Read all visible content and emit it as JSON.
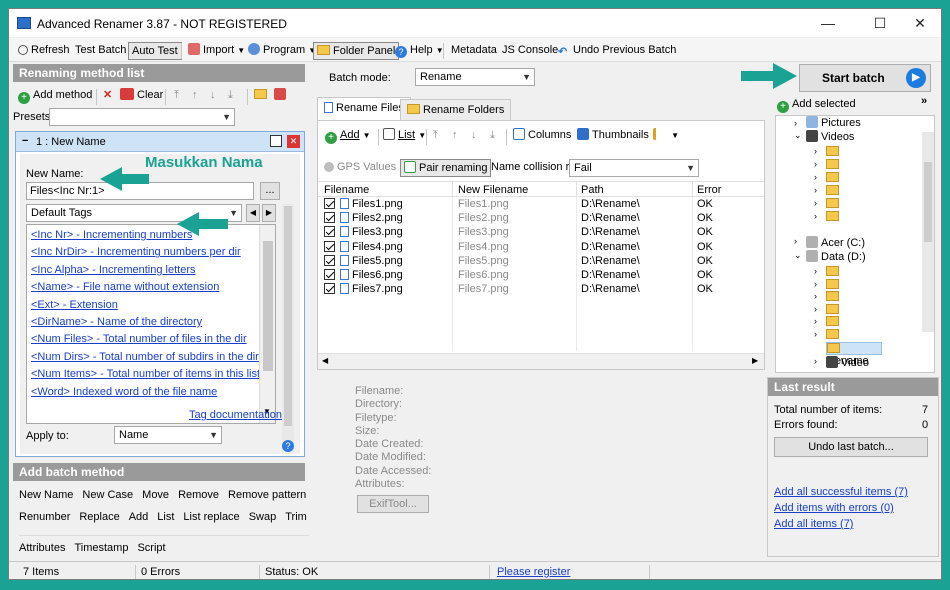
{
  "window": {
    "title": "Advanced Renamer 3.87 - NOT REGISTERED",
    "controls": {
      "minimize": "—",
      "maximize": "☐",
      "close": "✕"
    }
  },
  "toolbar": {
    "refresh": "Refresh",
    "test_batch": "Test Batch",
    "auto_test": "Auto Test",
    "import": "Import",
    "program": "Program",
    "folder_panel": "Folder Panel",
    "help": "Help",
    "metadata": "Metadata",
    "js_console": "JS Console",
    "undo_previous_batch": "Undo Previous Batch"
  },
  "methods_panel": {
    "header": "Renaming method list",
    "add_method": "Add method",
    "clear": "Clear",
    "presets_label": "Presets:",
    "presets_value": "",
    "method_title": "1 : New Name",
    "new_name_label": "New Name:",
    "new_name_value": "Files<Inc Nr:1>",
    "browse_btn": "...",
    "default_tags": "Default Tags",
    "tags": [
      "<Inc Nr> - Incrementing numbers",
      "<Inc NrDir> - Incrementing numbers per dir",
      "<Inc Alpha> - Incrementing letters",
      "<Name> - File name without extension",
      "<Ext> - Extension",
      "<DirName> - Name of the directory",
      "<Num Files> - Total number of files in the dir",
      "<Num Dirs> - Total number of subdirs in the dir",
      "<Num Items> - Total number of items in this list",
      "<Word> Indexed word of the file name"
    ],
    "tag_documentation": "Tag documentation",
    "apply_to_label": "Apply to:",
    "apply_to_value": "Name"
  },
  "annotations": {
    "masukkan_nama": "Masukkan Nama"
  },
  "batch_methods": {
    "header": "Add batch method",
    "rows": [
      [
        "New Name",
        "New Case",
        "Move",
        "Remove",
        "Remove pattern"
      ],
      [
        "Renumber",
        "Replace",
        "Add",
        "List",
        "List replace",
        "Swap",
        "Trim"
      ],
      [
        "Attributes",
        "Timestamp",
        "Script"
      ]
    ]
  },
  "center": {
    "batch_mode_label": "Batch mode:",
    "batch_mode_value": "Rename",
    "tab_files": "Rename Files",
    "tab_folders": "Rename Folders",
    "add": "Add",
    "list": "List",
    "columns": "Columns",
    "thumbnails": "Thumbnails",
    "gps_values": "GPS Values",
    "pair_renaming": "Pair renaming",
    "collision_label": "Name collision rule:",
    "collision_value": "Fail",
    "headers": [
      "Filename",
      "New Filename",
      "Path",
      "Error"
    ],
    "rows": [
      {
        "filename": "Files1.png",
        "new": "Files1.png",
        "path": "D:\\Rename\\",
        "error": "OK"
      },
      {
        "filename": "Files2.png",
        "new": "Files2.png",
        "path": "D:\\Rename\\",
        "error": "OK"
      },
      {
        "filename": "Files3.png",
        "new": "Files3.png",
        "path": "D:\\Rename\\",
        "error": "OK"
      },
      {
        "filename": "Files4.png",
        "new": "Files4.png",
        "path": "D:\\Rename\\",
        "error": "OK"
      },
      {
        "filename": "Files5.png",
        "new": "Files5.png",
        "path": "D:\\Rename\\",
        "error": "OK"
      },
      {
        "filename": "Files6.png",
        "new": "Files6.png",
        "path": "D:\\Rename\\",
        "error": "OK"
      },
      {
        "filename": "Files7.png",
        "new": "Files7.png",
        "path": "D:\\Rename\\",
        "error": "OK"
      }
    ],
    "info_labels": [
      "Filename:",
      "Directory:",
      "Filetype:",
      "Size:",
      "Date Created:",
      "Date Modified:",
      "Date Accessed:",
      "Attributes:"
    ],
    "exiftool": "ExifTool..."
  },
  "right": {
    "start_batch": "Start batch",
    "add_selected": "Add selected",
    "tree": {
      "pictures": "Pictures",
      "videos": "Videos",
      "acer": "Acer (C:)",
      "data": "Data  (D:)",
      "rename": "Rename",
      "video": "Video",
      "partial": "..."
    },
    "last_result_header": "Last result",
    "total_label": "Total number of items:",
    "total_value": "7",
    "errors_label": "Errors found:",
    "errors_value": "0",
    "undo_last_batch": "Undo last batch...",
    "links": [
      "Add all successful items (7)",
      "Add items with errors (0)",
      "Add all items (7)"
    ]
  },
  "status": {
    "items": "7 Items",
    "errors": "0 Errors",
    "status": "Status: OK",
    "register": "Please register"
  },
  "colors": {
    "accent_teal": "#1aa394",
    "panel_header": "#9a9a9a",
    "link_blue": "#1a3fc8",
    "method_header": "#cfe3f7"
  }
}
